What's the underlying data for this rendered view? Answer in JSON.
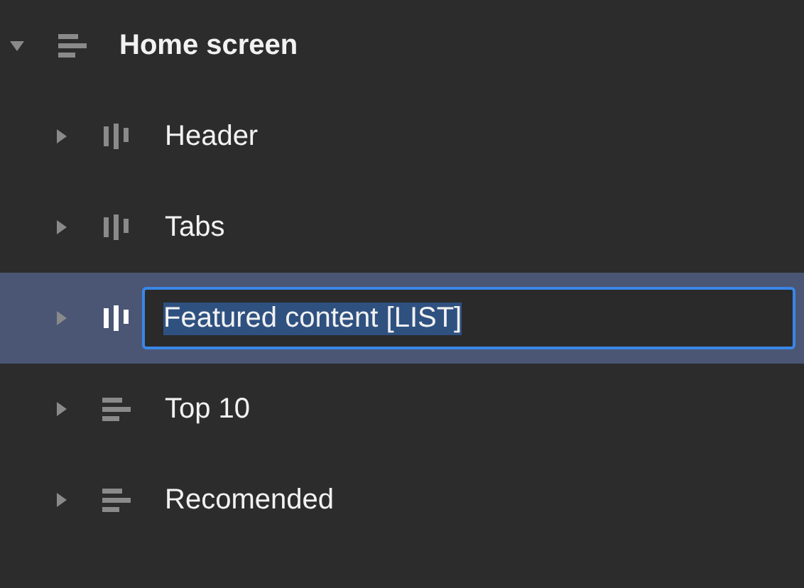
{
  "tree": {
    "label": "Home screen",
    "expanded": true,
    "kind": "rows",
    "selected": false,
    "children": [
      {
        "label": "Header",
        "expanded": false,
        "kind": "columns",
        "selected": false,
        "editing": false
      },
      {
        "label": "Tabs",
        "expanded": false,
        "kind": "columns",
        "selected": false,
        "editing": false
      },
      {
        "label": "Featured content [LIST]",
        "expanded": false,
        "kind": "columns",
        "selected": true,
        "editing": true
      },
      {
        "label": "Top 10",
        "expanded": false,
        "kind": "rows",
        "selected": false,
        "editing": false
      },
      {
        "label": "Recomended",
        "expanded": false,
        "kind": "rows",
        "selected": false,
        "editing": false
      }
    ]
  }
}
